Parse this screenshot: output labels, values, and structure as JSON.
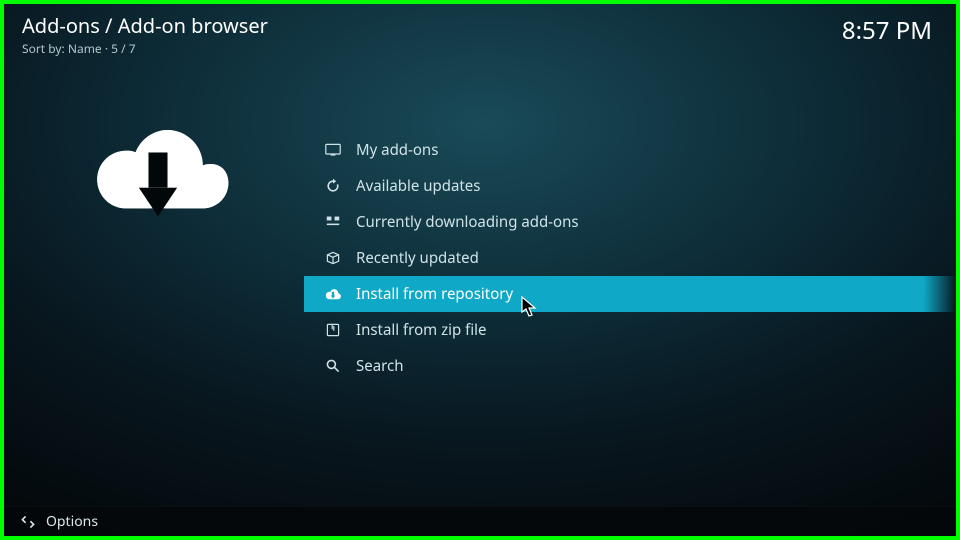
{
  "header": {
    "title": "Add-ons / Add-on browser",
    "sort_prefix": "Sort by: ",
    "sort_value": "Name",
    "count_sep": " · ",
    "count": "5 / 7"
  },
  "clock": "8:57 PM",
  "menu": {
    "items": [
      {
        "label": "My add-ons",
        "icon": "addons-icon",
        "selected": false
      },
      {
        "label": "Available updates",
        "icon": "refresh-icon",
        "selected": false
      },
      {
        "label": "Currently downloading add-ons",
        "icon": "downloading-icon",
        "selected": false
      },
      {
        "label": "Recently updated",
        "icon": "box-icon",
        "selected": false
      },
      {
        "label": "Install from repository",
        "icon": "cloud-download-icon",
        "selected": true
      },
      {
        "label": "Install from zip file",
        "icon": "zip-icon",
        "selected": false
      },
      {
        "label": "Search",
        "icon": "search-icon",
        "selected": false
      }
    ]
  },
  "footer": {
    "options_label": "Options"
  }
}
